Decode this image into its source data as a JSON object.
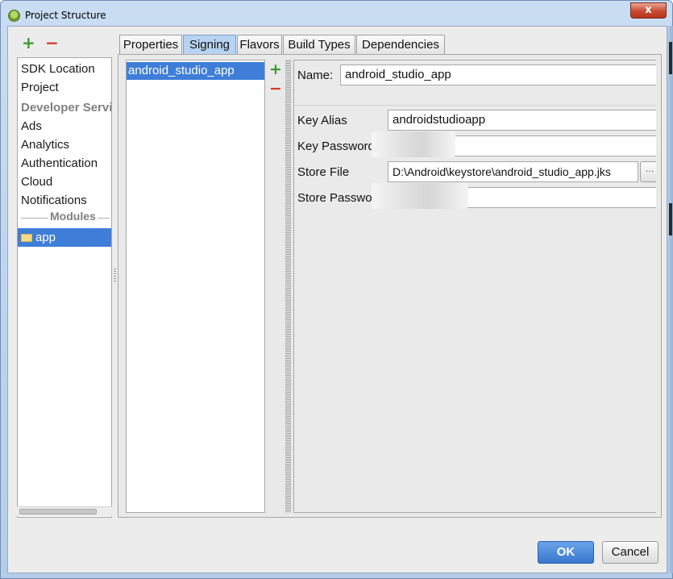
{
  "window": {
    "title": "Project Structure",
    "close_label": "x"
  },
  "sidebar": {
    "add_label": "+",
    "remove_label": "−",
    "items": [
      {
        "label": "SDK Location"
      },
      {
        "label": "Project"
      },
      {
        "label": "Developer Servic"
      },
      {
        "label": "Ads"
      },
      {
        "label": "Analytics"
      },
      {
        "label": "Authentication"
      },
      {
        "label": "Cloud"
      },
      {
        "label": "Notifications"
      }
    ],
    "modules_label": "Modules",
    "module_item": "app"
  },
  "tabs": [
    {
      "label": "Properties"
    },
    {
      "label": "Signing"
    },
    {
      "label": "Flavors"
    },
    {
      "label": "Build Types"
    },
    {
      "label": "Dependencies"
    }
  ],
  "active_tab": "Signing",
  "signing": {
    "configs": [
      "android_studio_app"
    ],
    "add_label": "+",
    "remove_label": "−",
    "form": {
      "name_label": "Name:",
      "name_value": "android_studio_app",
      "key_alias_label": "Key Alias",
      "key_alias_value": "androidstudioapp",
      "key_password_label": "Key Password",
      "store_file_label": "Store File",
      "store_file_value": "D:\\Android\\keystore\\android_studio_app.jks",
      "browse_label": "...",
      "store_password_label": "Store Password"
    }
  },
  "buttons": {
    "ok": "OK",
    "cancel": "Cancel"
  },
  "colors": {
    "selection": "#3f7ed8",
    "add": "#3a9a2e",
    "remove": "#d23a2a",
    "ok_button": "#3a77cd"
  }
}
